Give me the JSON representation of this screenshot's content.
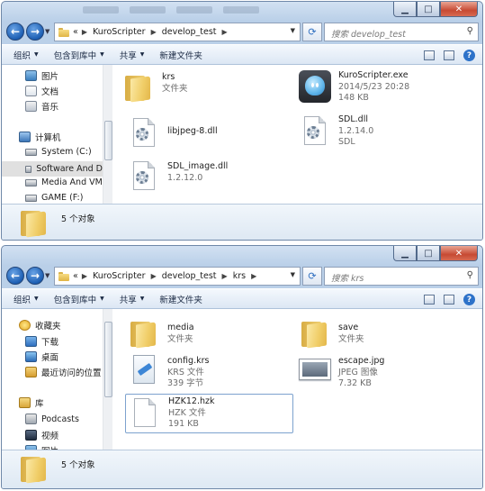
{
  "window1": {
    "address": {
      "prefix": "«",
      "crumbs": [
        "KuroScripter",
        "develop_test"
      ]
    },
    "search_placeholder": "搜索 develop_test",
    "toolbar": {
      "organize": "组织",
      "include_library": "包含到库中",
      "share": "共享",
      "new_folder": "新建文件夹"
    },
    "nav": [
      {
        "label": "图片",
        "icon": "pictures-icon"
      },
      {
        "label": "文档",
        "icon": "documents-icon"
      },
      {
        "label": "音乐",
        "icon": "music-icon"
      },
      {
        "label": "计算机",
        "icon": "computer-icon"
      },
      {
        "label": "System (C:)",
        "icon": "drive-icon"
      },
      {
        "label": "Software And D",
        "icon": "drive-icon",
        "selected": true
      },
      {
        "label": "Media And VM",
        "icon": "drive-icon"
      },
      {
        "label": "GAME (F:)",
        "icon": "drive-icon"
      }
    ],
    "files": [
      {
        "name": "krs",
        "line2": "文件夹",
        "line3": "",
        "icon": "folder-icon"
      },
      {
        "name": "KuroScripter.exe",
        "line2": "2014/5/23 20:28",
        "line3": "148 KB",
        "icon": "exe-icon"
      },
      {
        "name": "libjpeg-8.dll",
        "line2": "",
        "line3": "",
        "icon": "dll-icon"
      },
      {
        "name": "SDL.dll",
        "line2": "1.2.14.0",
        "line3": "SDL",
        "icon": "dll-icon"
      },
      {
        "name": "SDL_image.dll",
        "line2": "1.2.12.0",
        "line3": "",
        "icon": "dll-icon"
      }
    ],
    "status": "5 个对象"
  },
  "window2": {
    "address": {
      "prefix": "«",
      "crumbs": [
        "KuroScripter",
        "develop_test",
        "krs"
      ]
    },
    "search_placeholder": "搜索 krs",
    "toolbar": {
      "organize": "组织",
      "include_library": "包含到库中",
      "share": "共享",
      "new_folder": "新建文件夹"
    },
    "nav": [
      {
        "label": "收藏夹",
        "icon": "favorites-icon"
      },
      {
        "label": "下载",
        "icon": "downloads-icon"
      },
      {
        "label": "桌面",
        "icon": "desktop-icon"
      },
      {
        "label": "最近访问的位置",
        "icon": "recent-places-icon"
      },
      {
        "label": "库",
        "icon": "libraries-icon"
      },
      {
        "label": "Podcasts",
        "icon": "podcasts-icon"
      },
      {
        "label": "视频",
        "icon": "videos-icon"
      },
      {
        "label": "图片",
        "icon": "pictures-icon"
      }
    ],
    "files": [
      {
        "name": "media",
        "line2": "文件夹",
        "line3": "",
        "icon": "folder-icon"
      },
      {
        "name": "save",
        "line2": "文件夹",
        "line3": "",
        "icon": "folder-icon"
      },
      {
        "name": "config.krs",
        "line2": "KRS 文件",
        "line3": "339 字节",
        "icon": "config-file-icon"
      },
      {
        "name": "escape.jpg",
        "line2": "JPEG 图像",
        "line3": "7.32 KB",
        "icon": "image-file-icon"
      },
      {
        "name": "HZK12.hzk",
        "line2": "HZK 文件",
        "line3": "191 KB",
        "icon": "generic-file-icon"
      }
    ],
    "status": "5 个对象"
  }
}
